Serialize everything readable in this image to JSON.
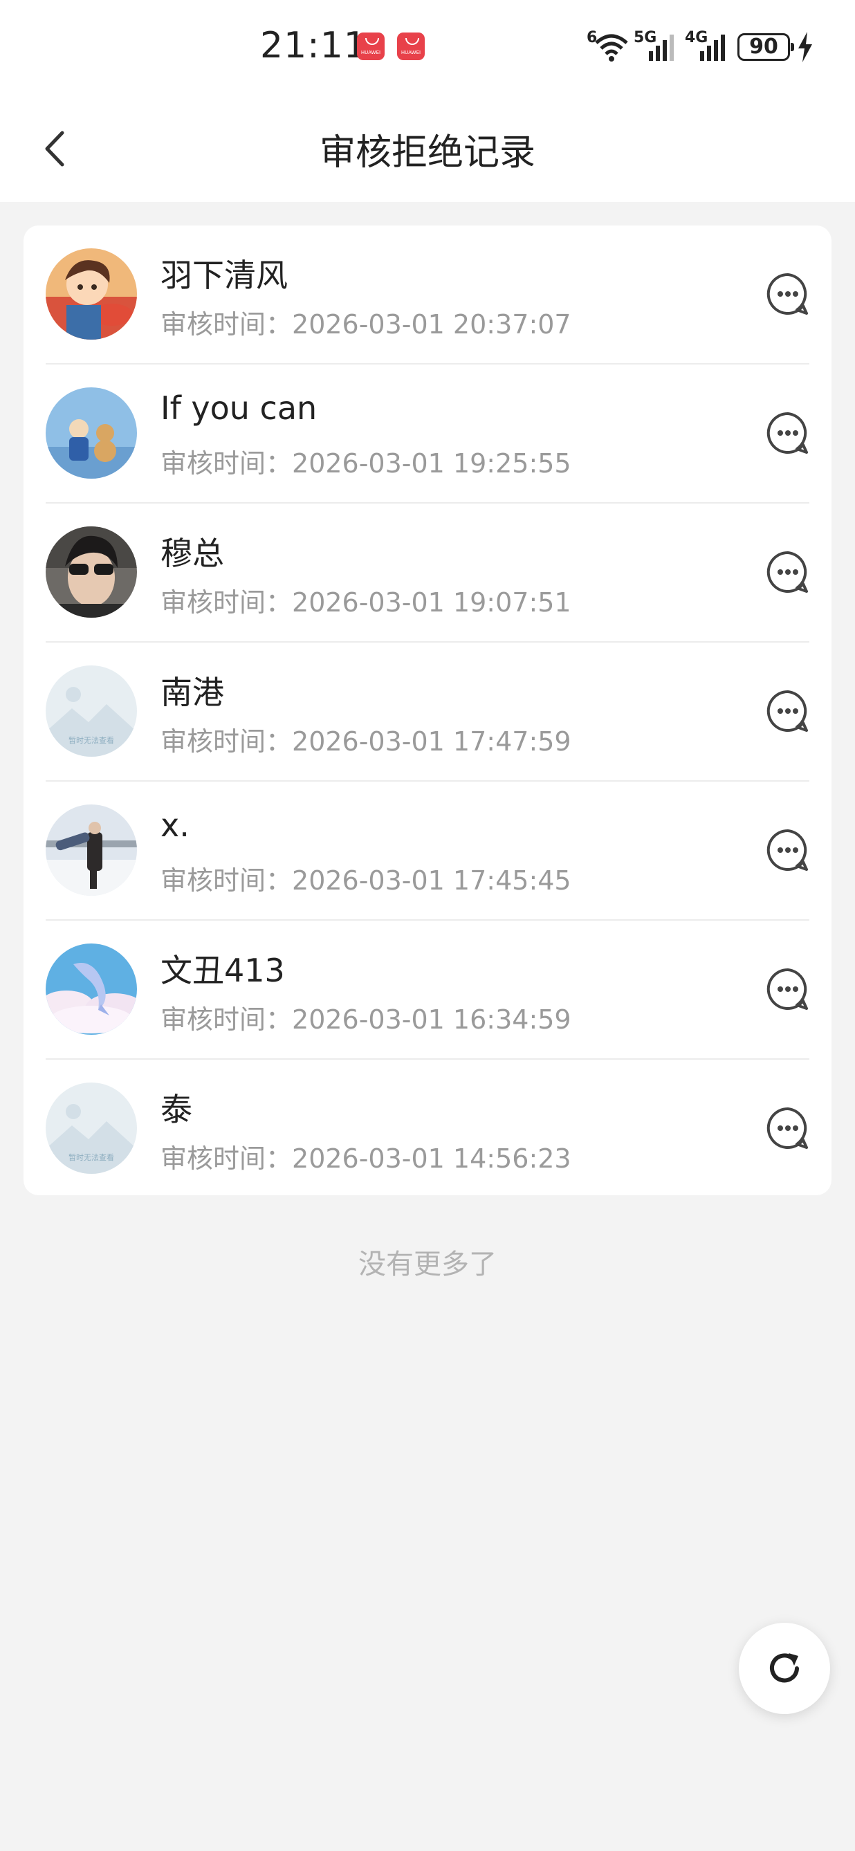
{
  "status_bar": {
    "time": "21:11",
    "app_badges": [
      "HUAWEI",
      "HUAWEI"
    ],
    "wifi_label": "6",
    "sim1_label": "5G",
    "sim2_label": "4G",
    "battery": "90"
  },
  "header": {
    "title": "审核拒绝记录"
  },
  "records": [
    {
      "name": "羽下清风",
      "time_label": "审核时间：",
      "time": "2026-03-01 20:37:07",
      "avatar": "anime-boy-with-fish"
    },
    {
      "name": "If you can",
      "time_label": "审核时间：",
      "time": "2026-03-01 19:25:55",
      "avatar": "boy-and-dog-sky"
    },
    {
      "name": "穆总",
      "time_label": "审核时间：",
      "time": "2026-03-01 19:07:51",
      "avatar": "boy-with-sunglasses"
    },
    {
      "name": "南港",
      "time_label": "审核时间：",
      "time": "2026-03-01 17:47:59",
      "avatar": "placeholder-image",
      "avatar_text": "暂时无法查看"
    },
    {
      "name": "x.",
      "time_label": "审核时间：",
      "time": "2026-03-01 17:45:45",
      "avatar": "two-people-snow"
    },
    {
      "name": "文丑413",
      "time_label": "审核时间：",
      "time": "2026-03-01 16:34:59",
      "avatar": "whale-clouds"
    },
    {
      "name": "泰",
      "time_label": "审核时间：",
      "time": "2026-03-01 14:56:23",
      "avatar": "placeholder-image",
      "avatar_text": "暂时无法查看"
    }
  ],
  "footer": {
    "no_more": "没有更多了"
  },
  "colors": {
    "page_bg": "#f3f3f3",
    "card_bg": "#ffffff",
    "time_text": "#9a9a9a",
    "badge_red": "#e8414a"
  },
  "icons": {
    "back": "chevron-left-icon",
    "chat": "chat-bubble-icon",
    "refresh": "refresh-icon"
  }
}
